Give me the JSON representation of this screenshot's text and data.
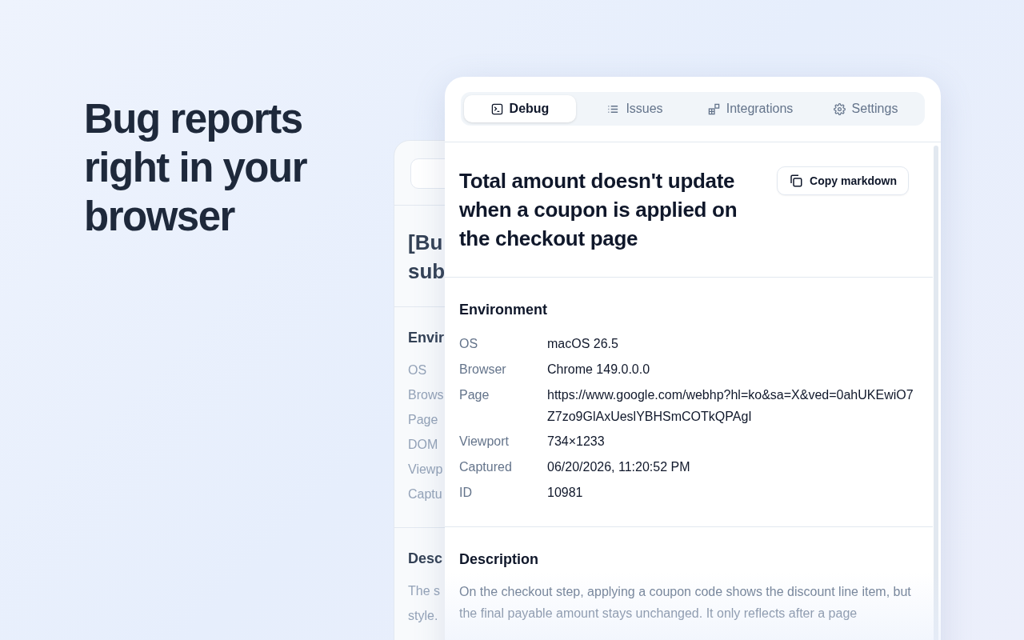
{
  "headline": "Bug reports right in your browser",
  "back_card": {
    "title_lines": [
      "[Bu",
      "sub"
    ],
    "section": "Envir",
    "labels": [
      "OS",
      "Brows",
      "Page",
      "DOM",
      "Viewp",
      "Captu"
    ],
    "section_2": "Desc",
    "text_lines": [
      "The s",
      "style."
    ]
  },
  "tabs": [
    {
      "label": "Debug",
      "selected": true
    },
    {
      "label": "Issues",
      "selected": false
    },
    {
      "label": "Integrations",
      "selected": false
    },
    {
      "label": "Settings",
      "selected": false
    }
  ],
  "report": {
    "title": "Total amount doesn't update when a coupon is applied on the checkout page",
    "copy_button": "Copy markdown",
    "environment": {
      "heading": "Environment",
      "rows": [
        {
          "label": "OS",
          "value": "macOS 26.5"
        },
        {
          "label": "Browser",
          "value": "Chrome 149.0.0.0"
        },
        {
          "label": "Page",
          "value": "https://www.google.com/webhp?hl=ko&sa=X&ved=0ahUKEwiO7Z7zo9GlAxUeslYBHSmCOTkQPAgI"
        },
        {
          "label": "Viewport",
          "value": "734×1233"
        },
        {
          "label": "Captured",
          "value": "06/20/2026, 11:20:52 PM"
        },
        {
          "label": "ID",
          "value": "10981"
        }
      ]
    },
    "description": {
      "heading": "Description",
      "text": "On the checkout step, applying a coupon code shows the discount line item, but the final payable amount stays unchanged. It only reflects after a page"
    }
  }
}
